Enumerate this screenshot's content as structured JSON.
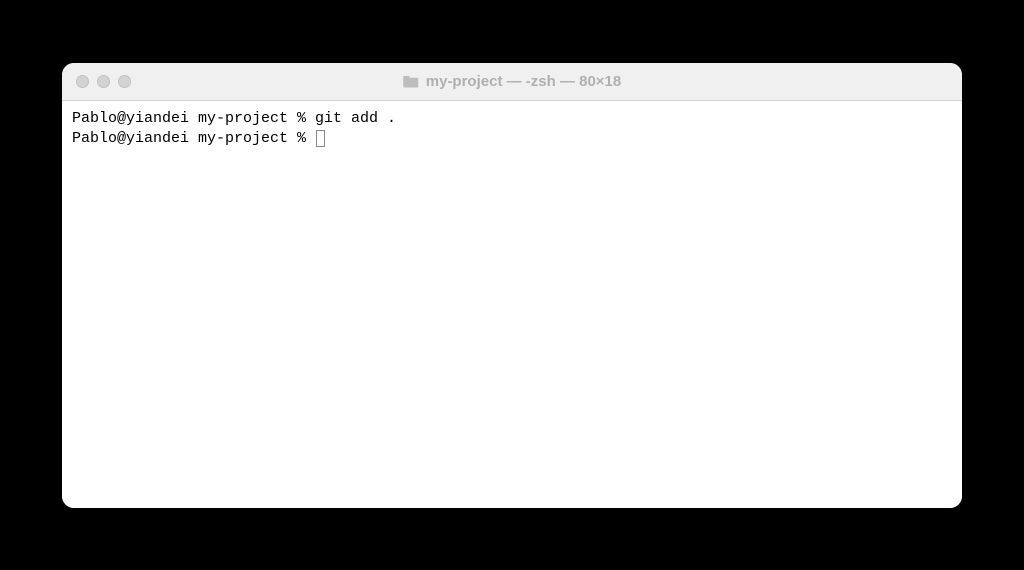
{
  "window": {
    "title": "my-project — -zsh — 80×18"
  },
  "terminal": {
    "lines": [
      {
        "prompt": "Pablo@yiandei my-project % ",
        "command": "git add ."
      },
      {
        "prompt": "Pablo@yiandei my-project % ",
        "command": ""
      }
    ]
  }
}
